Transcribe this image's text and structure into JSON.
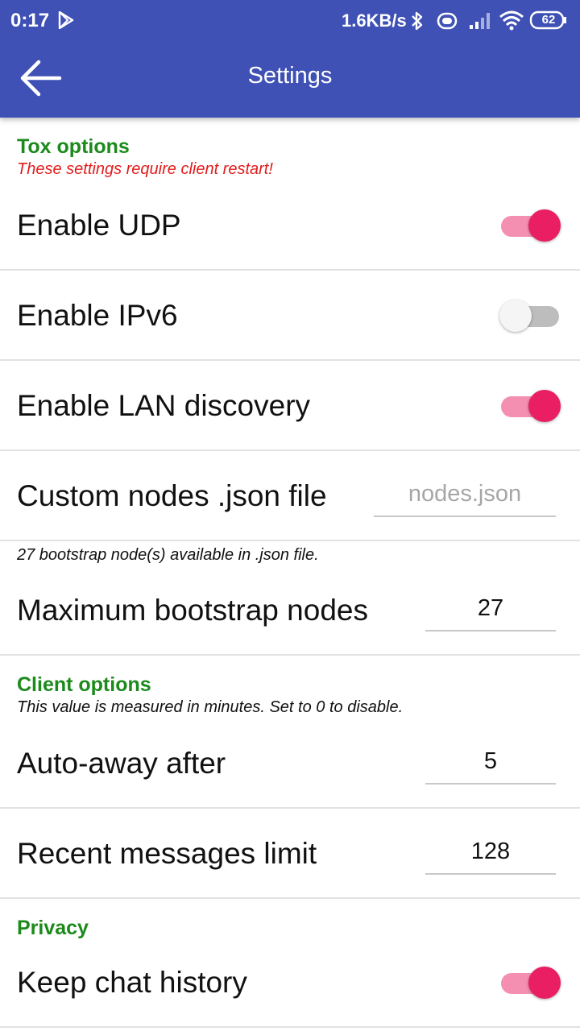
{
  "status_bar": {
    "time": "0:17",
    "speed": "1.6KB/s",
    "battery": "62",
    "icons": [
      "play-store-icon",
      "bluetooth-icon",
      "vibrate-icon",
      "signal-icon",
      "wifi-icon",
      "battery-icon"
    ]
  },
  "appbar": {
    "back_icon": "arrow-back-icon",
    "title": "Settings",
    "color": "#3f51b5"
  },
  "tox": {
    "header": "Tox options",
    "note": "These settings require client restart!",
    "enable_udp": {
      "label": "Enable UDP",
      "checked": true
    },
    "enable_ipv6": {
      "label": "Enable IPv6",
      "checked": false
    },
    "enable_lan": {
      "label": "Enable LAN discovery",
      "checked": true
    },
    "custom_nodes": {
      "label": "Custom nodes .json file",
      "value": "",
      "placeholder": "nodes.json"
    },
    "bootstrap_note": "27 bootstrap node(s) available in .json file.",
    "max_bootstrap": {
      "label": "Maximum bootstrap nodes",
      "value": "27"
    }
  },
  "client": {
    "header": "Client options",
    "note": "This value is measured in minutes. Set to 0 to disable.",
    "auto_away": {
      "label": "Auto-away after",
      "value": "5"
    },
    "recent_limit": {
      "label": "Recent messages limit",
      "value": "128"
    }
  },
  "privacy": {
    "header": "Privacy",
    "keep_history": {
      "label": "Keep chat history",
      "checked": true
    }
  },
  "colors": {
    "accent": "#e91e63",
    "category": "#1b8a1b",
    "warning": "#e31b1b"
  }
}
